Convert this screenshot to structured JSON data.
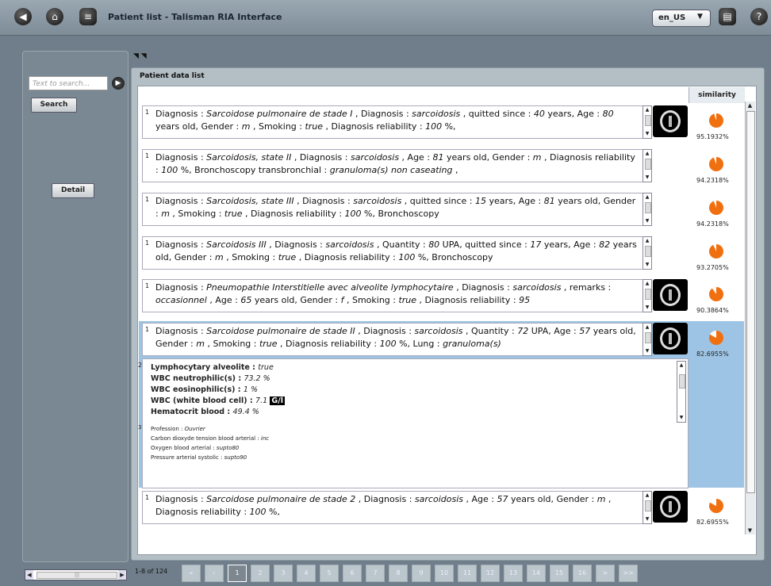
{
  "app": {
    "title": "Patient list - Talisman RIA Interface",
    "language": "en_US"
  },
  "toolbar": {
    "back_icon": "back-icon",
    "home_icon": "home-icon",
    "db_icon": "database-icon",
    "print_icon": "printer-icon",
    "help_icon": "help-icon",
    "lang_arrow": "▼"
  },
  "sidebar": {
    "search_placeholder": "Text to search...",
    "search_button": "Search",
    "detail_button": "Detail"
  },
  "panel": {
    "title": "Patient data list",
    "similarity_header": "similarity"
  },
  "rows": [
    {
      "num": "1",
      "html": "Diagnosis : <i>Sarcoidose pulmonaire de stade I</i> , Diagnosis : <i>sarcoidosis</i> , quitted since : <i>40</i> years, Age : <i>80</i> years old, Gender : <i>m</i> , Smoking : <i>true</i> , Diagnosis reliability : <i>100</i> %,",
      "similarity": "95.1932%",
      "pct": 95.1932,
      "ct": true
    },
    {
      "num": "1",
      "html": "Diagnosis : <i>Sarcoidosis, state II</i> , Diagnosis : <i>sarcoidosis</i> , Age : <i>81</i> years old, Gender : <i>m</i> , Diagnosis reliability : <i>100</i> %, Bronchoscopy transbronchial : <i>granuloma(s) non caseating</i> ,",
      "similarity": "94.2318%",
      "pct": 94.2318,
      "ct": false
    },
    {
      "num": "1",
      "html": "Diagnosis : <i>Sarcoidosis, state III</i> , Diagnosis : <i>sarcoidosis</i> , quitted since : <i>15</i> years, Age : <i>81</i> years old, Gender : <i>m</i> , Smoking : <i>true</i> , Diagnosis reliability : <i>100</i> %, Bronchoscopy",
      "similarity": "94.2318%",
      "pct": 94.2318,
      "ct": false
    },
    {
      "num": "1",
      "html": "Diagnosis : <i>Sarcoidosis III</i> , Diagnosis : <i>sarcoidosis</i> , Quantity : <i>80</i> UPA, quitted since : <i>17</i> years, Age : <i>82</i> years old, Gender : <i>m</i> , Smoking : <i>true</i> , Diagnosis reliability : <i>100</i> %, Bronchoscopy",
      "similarity": "93.2705%",
      "pct": 93.2705,
      "ct": false
    },
    {
      "num": "1",
      "html": "Diagnosis : <i>Pneumopathie Interstitielle avec alveolite lymphocytaire</i> , Diagnosis : <i>sarcoidosis</i> , remarks : <i>occasionnel</i> , Age : <i>65</i> years old, Gender : <i>f</i> , Smoking : <i>true</i> , Diagnosis reliability : <i>95</i>",
      "similarity": "90.3864%",
      "pct": 90.3864,
      "ct": true
    },
    {
      "num": "1",
      "html": "Diagnosis : <i>Sarcoidose pulmonaire de stade II</i> , Diagnosis : <i>sarcoidosis</i> , Quantity : <i>72</i> UPA, Age : <i>57</i> years old, Gender : <i>m</i> , Smoking : <i>true</i> , Diagnosis reliability : <i>100</i> %, Lung : <i>granuloma(s)</i>",
      "similarity": "82.6955%",
      "pct": 82.6955,
      "ct": true,
      "selected": true
    },
    {
      "num": "1",
      "html": "Diagnosis : <i>Sarcoidose pulmonaire de stade 2</i> , Diagnosis : <i>sarcoidosis</i> , Age : <i>57</i> years old, Gender : <i>m</i> , Diagnosis reliability : <i>100</i> %,",
      "similarity": "82.6955%",
      "pct": 82.6955,
      "ct": true
    }
  ],
  "detail": {
    "num2": "2",
    "labs": [
      {
        "label": "Lymphocytary alveolite :",
        "value": "true"
      },
      {
        "label": "WBC neutrophilic(s) :",
        "value": "73.2 %"
      },
      {
        "label": "WBC eosinophilic(s) :",
        "value": "1 %"
      },
      {
        "label": "WBC (white blood cell) :",
        "value": "7.1",
        "unit": "G/l"
      },
      {
        "label": "Hematocrit blood :",
        "value": "49.4 %"
      }
    ],
    "num3": "3",
    "extras": [
      {
        "label": "Profession :",
        "value": "Ouvrier"
      },
      {
        "label": "Carbon dioxyde tension blood arterial :",
        "value": "inc"
      },
      {
        "label": "Oxygen blood arterial :",
        "value": "supto80"
      },
      {
        "label": "Pressure arterial systolic :",
        "value": "supto90"
      }
    ]
  },
  "pager": {
    "info": "1-8 of 124",
    "pages": [
      "«",
      "‹",
      "1",
      "2",
      "3",
      "4",
      "5",
      "6",
      "7",
      "8",
      "9",
      "10",
      "11",
      "12",
      "13",
      "14",
      "15",
      "16",
      ">",
      ">>"
    ],
    "current": "1"
  },
  "colors": {
    "selected": "#9dc4e4",
    "pie": "#f07010"
  }
}
